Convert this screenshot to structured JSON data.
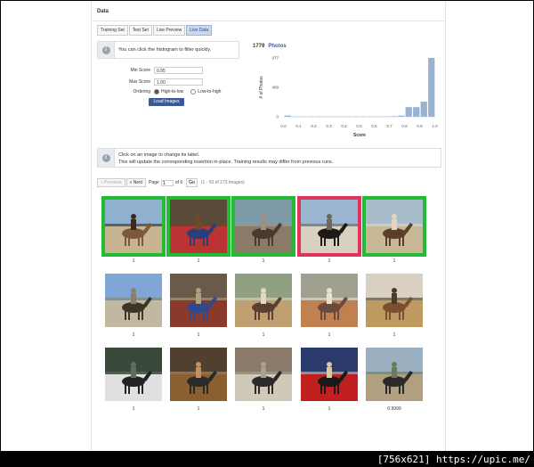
{
  "header": {
    "title": "Data"
  },
  "tabs": [
    {
      "label": "Training Set",
      "active": false
    },
    {
      "label": "Test Set",
      "active": false
    },
    {
      "label": "Live Preview",
      "active": false
    },
    {
      "label": "Live Data",
      "active": true
    }
  ],
  "filter": {
    "hint": "You can click the histogram to filter quickly.",
    "min_score_label": "Min Score",
    "min_score_value": "0.95",
    "max_score_label": "Max Score",
    "max_score_value": "1.00",
    "ordering_label": "Ordering",
    "ordering_options": [
      "High-to-low",
      "Low-to-high"
    ],
    "ordering_selected": "High-to-low",
    "load_button": "Load Images"
  },
  "histogram": {
    "count": "1779",
    "count_label": "Photos"
  },
  "chart_data": {
    "type": "bar",
    "title": "",
    "xlabel": "Score",
    "ylabel": "# of Photos",
    "x_ticks": [
      "0.0",
      "0.1",
      "0.2",
      "0.3",
      "0.4",
      "0.5",
      "0.6",
      "0.7",
      "0.8",
      "0.9",
      "1.0"
    ],
    "y_ticks": [
      "0",
      "489",
      "977"
    ],
    "ylim": [
      0,
      977
    ],
    "bins": [
      0.0,
      0.05,
      0.1,
      0.15,
      0.2,
      0.25,
      0.3,
      0.35,
      0.4,
      0.45,
      0.5,
      0.55,
      0.6,
      0.65,
      0.7,
      0.75,
      0.8,
      0.85,
      0.9,
      0.95
    ],
    "values": [
      20,
      5,
      5,
      5,
      5,
      5,
      5,
      5,
      5,
      5,
      5,
      5,
      5,
      5,
      10,
      20,
      160,
      160,
      250,
      977
    ],
    "color": "#9bb3d3",
    "grid": false
  },
  "info": {
    "line1": "Click on an image to change its label.",
    "line2": "This will update the corresponding insertion in-place. Training results may differ from previous runs."
  },
  "pager": {
    "previous": "« Previous",
    "next": "» Next",
    "page_label": "Page",
    "page_value": "1",
    "of_label": "of 6",
    "go": "Go",
    "range": "(1 - 50 of 273 images)"
  },
  "images": [
    {
      "score": "1",
      "border": "green"
    },
    {
      "score": "1",
      "border": "green"
    },
    {
      "score": "1",
      "border": "green"
    },
    {
      "score": "1",
      "border": "red"
    },
    {
      "score": "1",
      "border": "green"
    },
    {
      "score": "1",
      "border": "none"
    },
    {
      "score": "1",
      "border": "none"
    },
    {
      "score": "1",
      "border": "none"
    },
    {
      "score": "1",
      "border": "none"
    },
    {
      "score": "1",
      "border": "none"
    },
    {
      "score": "1",
      "border": "none"
    },
    {
      "score": "1",
      "border": "none"
    },
    {
      "score": "1",
      "border": "none"
    },
    {
      "score": "1",
      "border": "none"
    },
    {
      "score": "0.9999",
      "border": "none"
    }
  ],
  "watermark": "[756x621] https://upic.me/"
}
